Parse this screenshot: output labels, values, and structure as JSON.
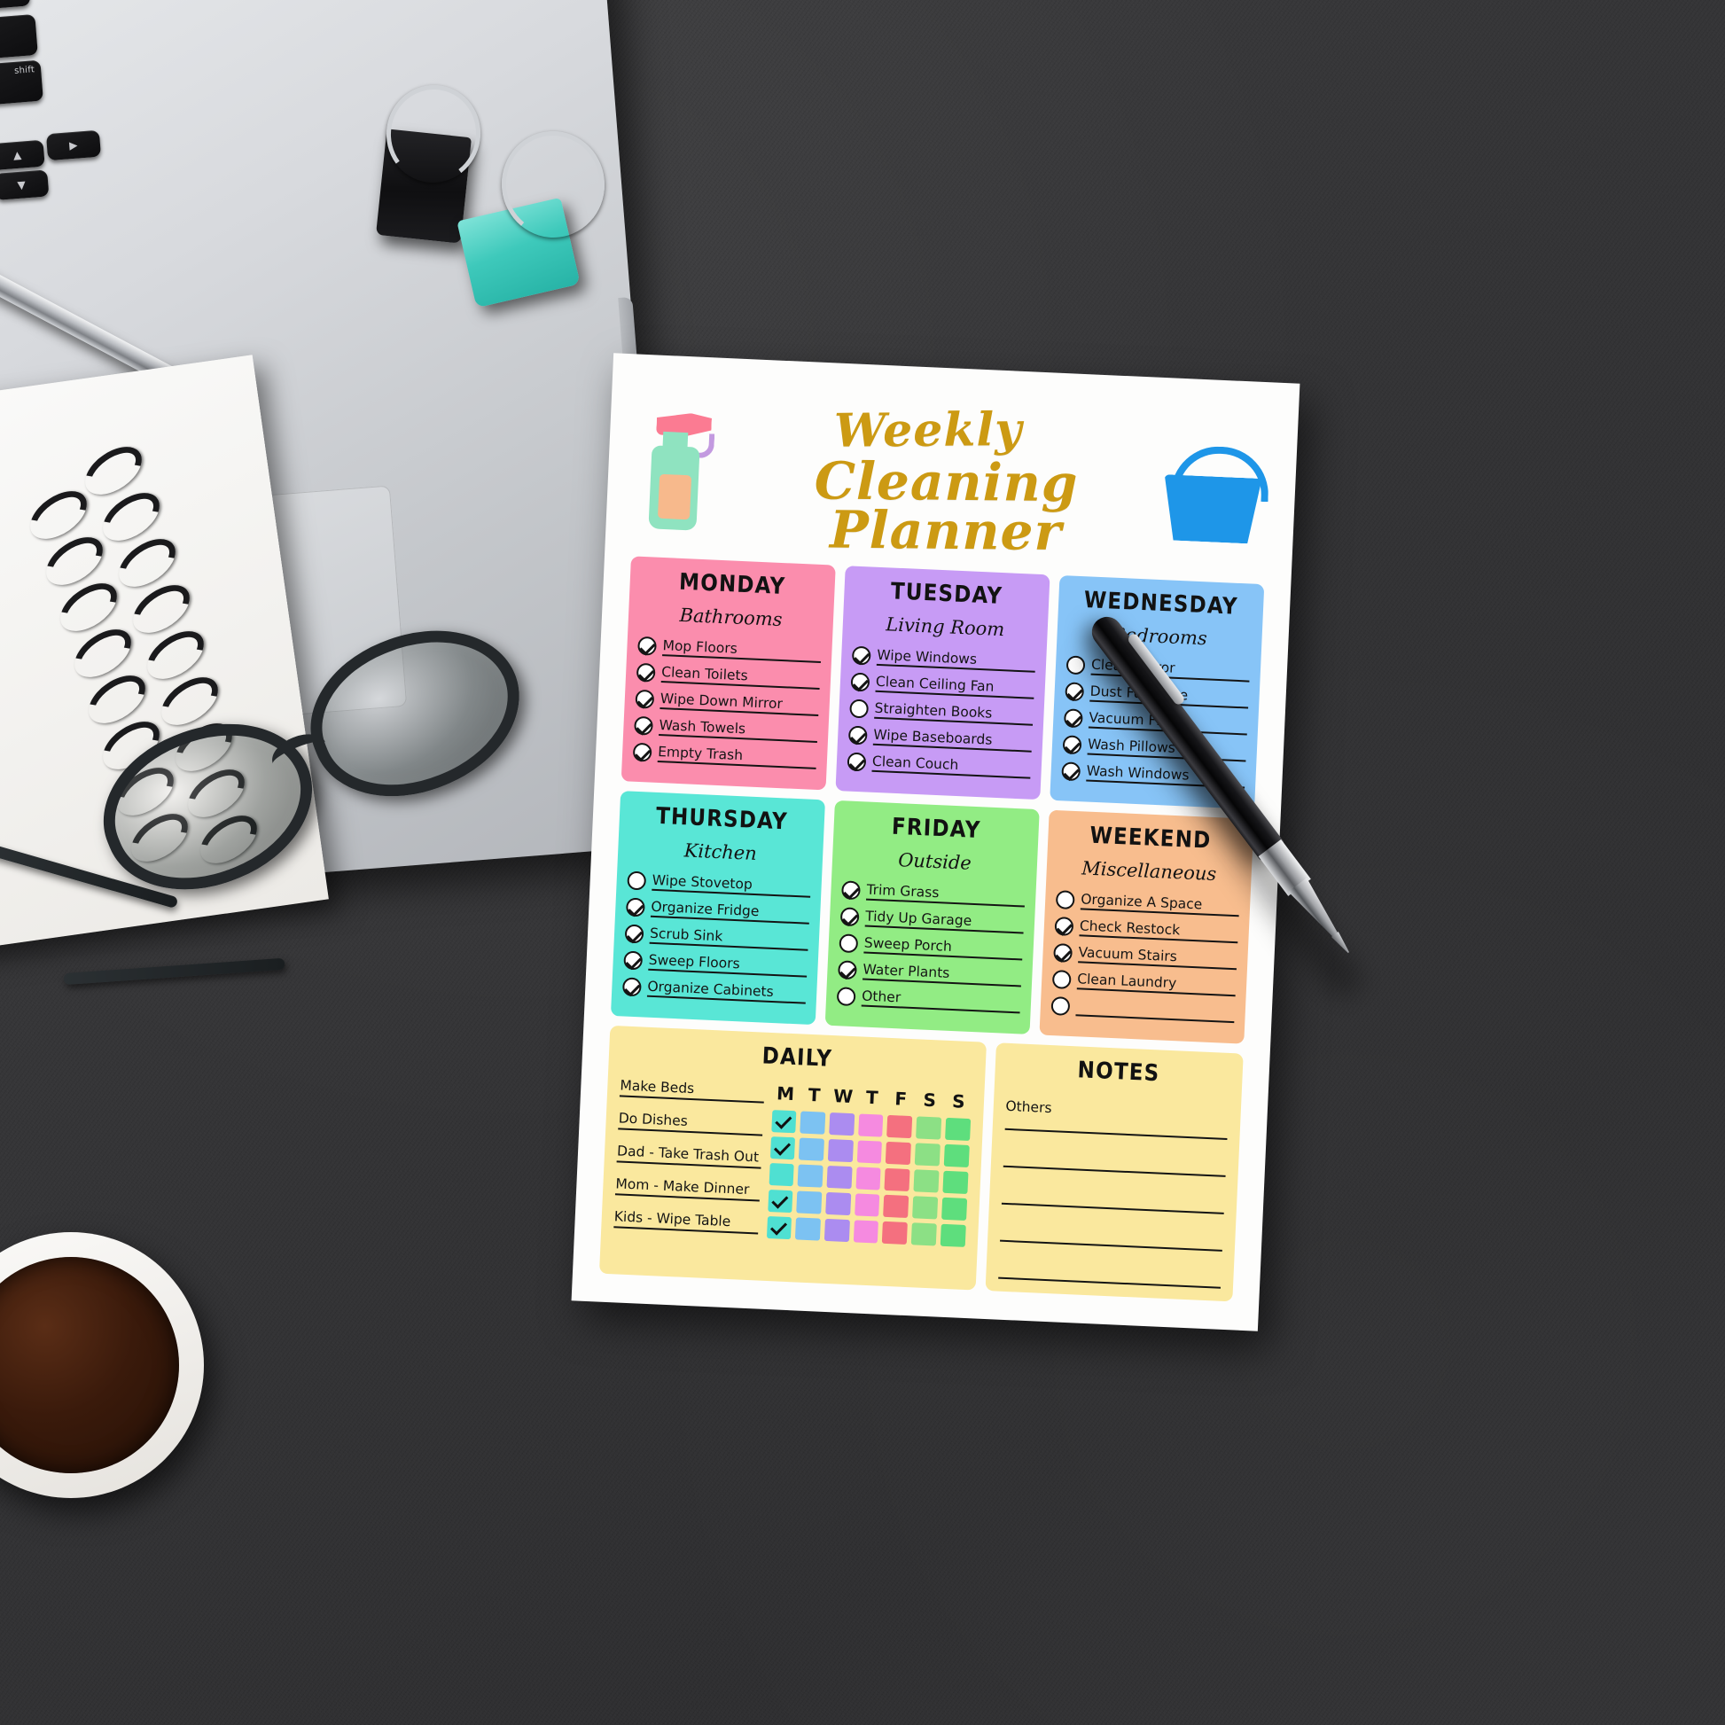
{
  "scene": {
    "description": "flat-lay desk with printed weekly cleaning planner",
    "desk_color": "#3a3a3c"
  },
  "planner": {
    "title_line1": "Weekly",
    "title_line2": "Cleaning Planner",
    "title_color": "#cc9a13",
    "icons": {
      "left": "spray-bottle-icon",
      "right": "bucket-icon"
    },
    "days": [
      {
        "name": "MONDAY",
        "area": "Bathrooms",
        "color": "#fb8dad",
        "tasks": [
          {
            "label": "Mop Floors",
            "checked": true
          },
          {
            "label": "Clean Toilets",
            "checked": true
          },
          {
            "label": "Wipe Down Mirror",
            "checked": true
          },
          {
            "label": "Wash Towels",
            "checked": true
          },
          {
            "label": "Empty Trash",
            "checked": true
          }
        ]
      },
      {
        "name": "TUESDAY",
        "area": "Living Room",
        "color": "#c79bf5",
        "tasks": [
          {
            "label": "Wipe Windows",
            "checked": true
          },
          {
            "label": "Clean Ceiling Fan",
            "checked": true
          },
          {
            "label": "Straighten Books",
            "checked": false
          },
          {
            "label": "Wipe Baseboards",
            "checked": true
          },
          {
            "label": "Clean Couch",
            "checked": true
          }
        ]
      },
      {
        "name": "WEDNESDAY",
        "area": "Bedrooms",
        "color": "#87c4f7",
        "tasks": [
          {
            "label": "Clean Mirror",
            "checked": false
          },
          {
            "label": "Dust Furniture",
            "checked": true
          },
          {
            "label": "Vacuum Floors",
            "checked": true
          },
          {
            "label": "Wash Pillows",
            "checked": true
          },
          {
            "label": "Wash Windows",
            "checked": true
          }
        ]
      },
      {
        "name": "THURSDAY",
        "area": "Kitchen",
        "color": "#59e6d6",
        "tasks": [
          {
            "label": "Wipe Stovetop",
            "checked": false
          },
          {
            "label": "Organize Fridge",
            "checked": true
          },
          {
            "label": "Scrub Sink",
            "checked": true
          },
          {
            "label": "Sweep Floors",
            "checked": true
          },
          {
            "label": "Organize Cabinets",
            "checked": true
          }
        ]
      },
      {
        "name": "FRIDAY",
        "area": "Outside",
        "color": "#92ec84",
        "tasks": [
          {
            "label": "Trim Grass",
            "checked": true
          },
          {
            "label": "Tidy Up Garage",
            "checked": true
          },
          {
            "label": "Sweep Porch",
            "checked": false
          },
          {
            "label": "Water Plants",
            "checked": true
          },
          {
            "label": "Other",
            "checked": false
          }
        ]
      },
      {
        "name": "WEEKEND",
        "area": "Miscellaneous",
        "color": "#f8bd8e",
        "tasks": [
          {
            "label": "Organize A Space",
            "checked": false
          },
          {
            "label": "Check Restock",
            "checked": true
          },
          {
            "label": "Vacuum Stairs",
            "checked": true
          },
          {
            "label": "Clean Laundry",
            "checked": false
          },
          {
            "label": "",
            "checked": false
          }
        ]
      }
    ],
    "daily": {
      "heading": "DAILY",
      "panel_color": "#fae89e",
      "tasks": [
        "Make Beds",
        "Do Dishes",
        "Dad - Take Trash Out",
        "Mom - Make Dinner",
        "Kids - Wipe Table"
      ],
      "day_headers": [
        "M",
        "T",
        "W",
        "T",
        "F",
        "S",
        "S"
      ],
      "column_colors": [
        "#4fe0d2",
        "#7cc2f2",
        "#ab8cf0",
        "#f58ae0",
        "#f4707f",
        "#8ce085",
        "#5ede7d"
      ],
      "checked_grid": [
        [
          true,
          false,
          false,
          false,
          false,
          false,
          false
        ],
        [
          true,
          false,
          false,
          false,
          false,
          false,
          false
        ],
        [
          false,
          false,
          false,
          false,
          false,
          false,
          false
        ],
        [
          true,
          false,
          false,
          false,
          false,
          false,
          false
        ],
        [
          true,
          false,
          false,
          false,
          false,
          false,
          false
        ]
      ]
    },
    "notes": {
      "heading": "NOTES",
      "first_line_label": "Others",
      "blank_lines": 4
    }
  }
}
